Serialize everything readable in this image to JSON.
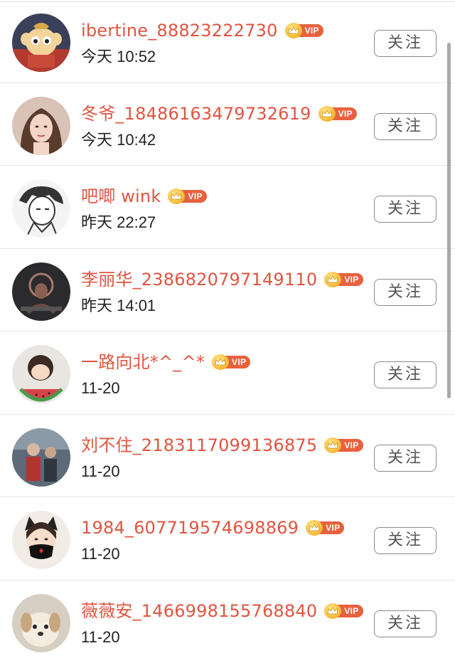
{
  "follow_label": "关注",
  "vip_label": "VIP",
  "colors": {
    "name": "#e05541",
    "vip_tag": "#e8613e",
    "vip_crown": "#f5b631",
    "button_border": "#8a8a8a",
    "divider": "#e6e6e6"
  },
  "users": [
    {
      "name": "ibertine_88823222730",
      "time": "今天 10:52",
      "avatar": "cartoon-monkey-avatar"
    },
    {
      "name": "冬爷_18486163479732619",
      "time": "今天 10:42",
      "avatar": "woman-portrait-avatar"
    },
    {
      "name": "吧唧 wink",
      "time": "昨天 22:27",
      "avatar": "manga-sketch-avatar"
    },
    {
      "name": "李丽华_2386820797149110",
      "time": "昨天 14:01",
      "avatar": "dark-photo-avatar"
    },
    {
      "name": "一路向北*^_^*",
      "time": "11-20",
      "avatar": "cartoon-watermelon-avatar"
    },
    {
      "name": "刘不住_2183117099136875",
      "time": "11-20",
      "avatar": "people-photo-avatar"
    },
    {
      "name": "1984_607719574698869",
      "time": "11-20",
      "avatar": "cat-ears-mask-avatar"
    },
    {
      "name": "薇薇安_1466998155768840",
      "time": "11-20",
      "avatar": "puppy-photo-avatar"
    }
  ]
}
